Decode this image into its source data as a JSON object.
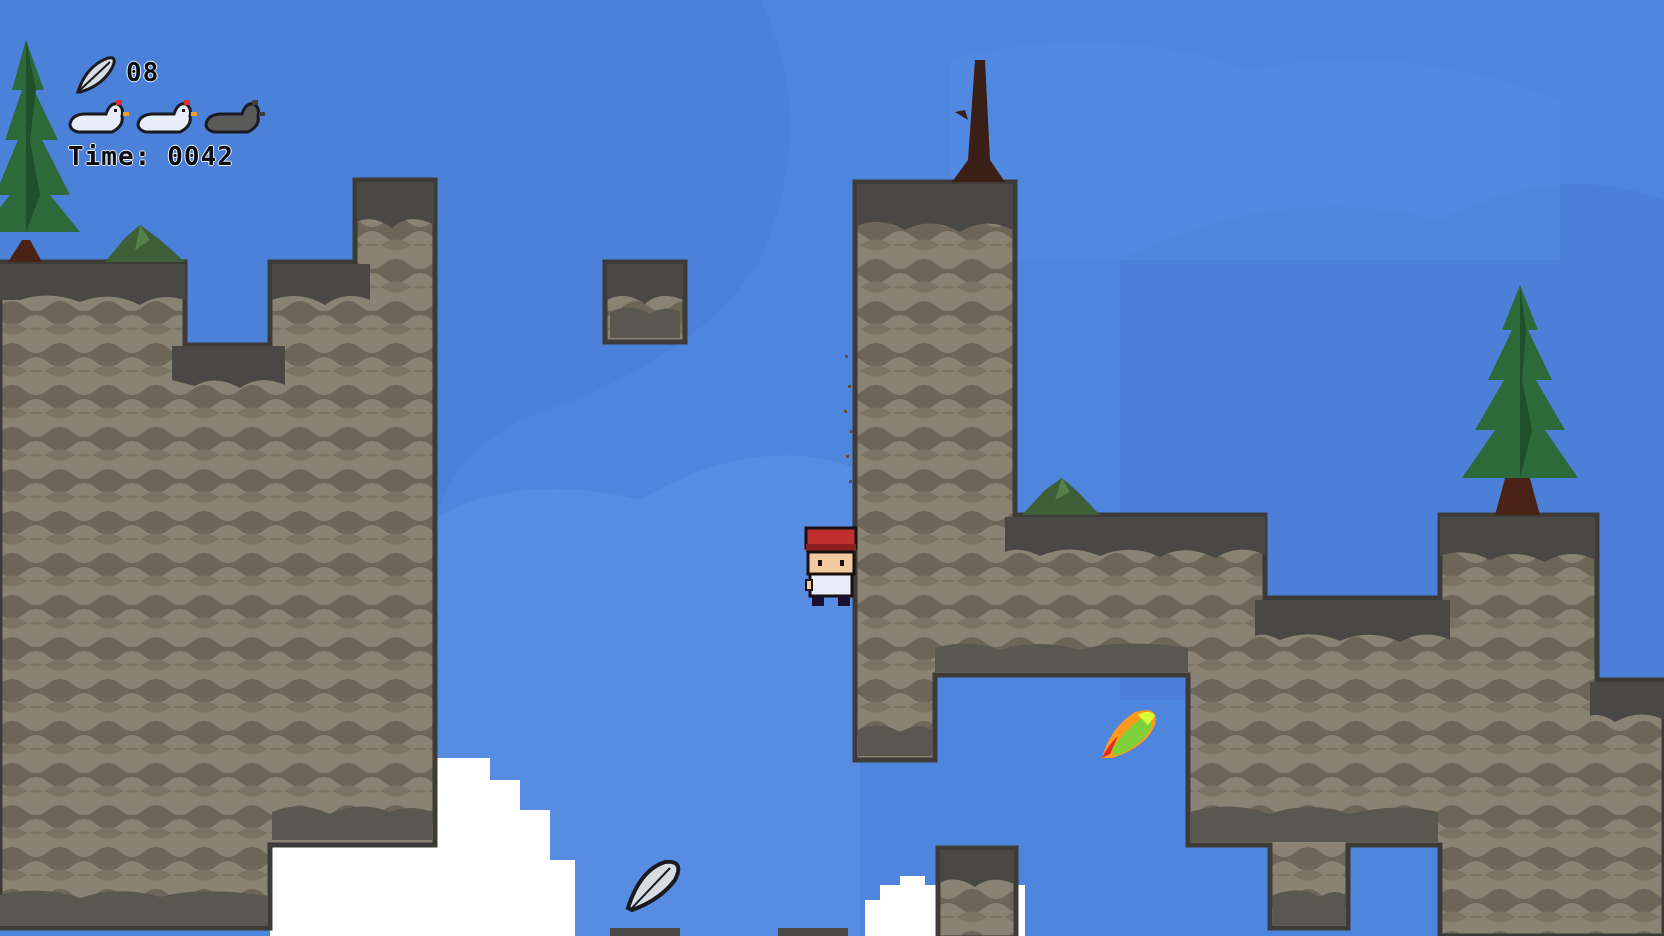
{
  "hud": {
    "feather_icon": "feather-icon",
    "feather_count": "08",
    "lives": [
      {
        "icon": "chicken-life-icon",
        "state": "full"
      },
      {
        "icon": "chicken-life-icon",
        "state": "full"
      },
      {
        "icon": "chicken-life-icon",
        "state": "lost"
      }
    ],
    "time_label": "Time:",
    "time_value": "0042"
  },
  "colors": {
    "sky": "#4f86dd",
    "sky_light": "#5b92e6",
    "sky_dark": "#4379cf",
    "rock_light": "#8a8273",
    "rock_dark": "#6c6558",
    "rock_edge": "#3d3b38",
    "cloud": "#ffffff",
    "tree_green": "#2d6a3a",
    "trunk": "#4a2316"
  },
  "scene": {
    "player": {
      "icon": "player-character",
      "hat": "red-hat"
    },
    "pickups": [
      {
        "icon": "silver-feather-pickup"
      },
      {
        "icon": "rainbow-feather-pickup"
      }
    ]
  }
}
